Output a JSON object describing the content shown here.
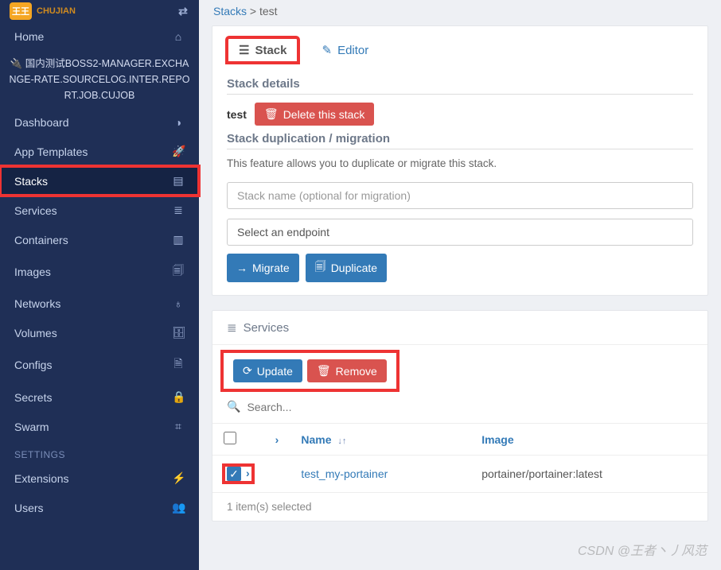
{
  "logo": {
    "badge": "王王",
    "sub": "CHUJIAN"
  },
  "breadcrumb": {
    "parent": "Stacks",
    "sep": ">",
    "current": "test"
  },
  "endpoint": {
    "prefix_icon": "🔌",
    "text": "国内测试BOSS2-MANAGER.EXCHANGE-RATE.SOURCELOG.INTER.REPORT.JOB.CUJOB"
  },
  "nav": {
    "home": "Home",
    "items": [
      {
        "label": "Dashboard",
        "icon": "◑"
      },
      {
        "label": "App Templates",
        "icon": "🚀"
      },
      {
        "label": "Stacks",
        "icon": "▤",
        "active": true
      },
      {
        "label": "Services",
        "icon": "≣"
      },
      {
        "label": "Containers",
        "icon": "▥"
      },
      {
        "label": "Images",
        "icon": "🗐"
      },
      {
        "label": "Networks",
        "icon": "♁"
      },
      {
        "label": "Volumes",
        "icon": "🗄"
      },
      {
        "label": "Configs",
        "icon": "🗎"
      },
      {
        "label": "Secrets",
        "icon": "🔒"
      },
      {
        "label": "Swarm",
        "icon": "⌗"
      }
    ],
    "section": "SETTINGS",
    "settings": [
      {
        "label": "Extensions",
        "icon": "⚡"
      },
      {
        "label": "Users",
        "icon": "👥"
      }
    ]
  },
  "tabs": {
    "stack": "Stack",
    "editor": "Editor"
  },
  "details": {
    "heading": "Stack details",
    "name": "test",
    "delete": "Delete this stack"
  },
  "dup": {
    "heading": "Stack duplication / migration",
    "descr": "This feature allows you to duplicate or migrate this stack.",
    "name_ph": "Stack name (optional for migration)",
    "endpoint_ph": "Select an endpoint",
    "migrate": "Migrate",
    "duplicate": "Duplicate"
  },
  "services": {
    "heading": "Services",
    "update": "Update",
    "remove": "Remove",
    "search_ph": "Search...",
    "col_name": "Name",
    "col_image": "Image",
    "rows": [
      {
        "name": "test_my-portainer",
        "image": "portainer/portainer:latest",
        "checked": true
      }
    ],
    "selected": "1 item(s) selected"
  },
  "watermark": "CSDN @王者丶丿风范"
}
